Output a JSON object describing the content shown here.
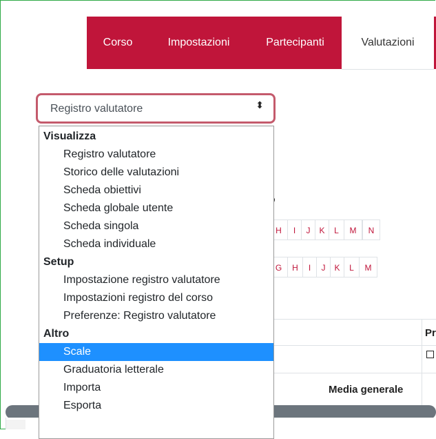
{
  "nav": {
    "tabs": [
      {
        "label": "Corso"
      },
      {
        "label": "Impostazioni"
      },
      {
        "label": "Partecipanti"
      },
      {
        "label": "Valutazioni"
      }
    ]
  },
  "select": {
    "value": "Registro valutatore",
    "arrow": "⬍"
  },
  "background": {
    "title_fragment": "B",
    "row1_letters": [
      "H",
      "I",
      "J",
      "K",
      "L",
      "M",
      "N"
    ],
    "row2_letters": [
      "G",
      "H",
      "I",
      "J",
      "K",
      "L",
      "M"
    ],
    "column_header_fragment": "Pr",
    "media_label": "Media generale"
  },
  "dropdown": {
    "groups": [
      {
        "label": "Visualizza",
        "options": [
          "Registro valutatore",
          "Storico delle valutazioni",
          "Scheda obiettivi",
          "Scheda globale utente",
          "Scheda singola",
          "Scheda individuale"
        ]
      },
      {
        "label": "Setup",
        "options": [
          "Impostazione registro valutatore",
          "Impostazioni registro del corso",
          "Preferenze: Registro valutatore"
        ]
      },
      {
        "label": "Altro",
        "options": [
          "Scale",
          "Graduatoria letterale",
          "Importa",
          "Esporta"
        ]
      }
    ],
    "selected": "Scale"
  },
  "colors": {
    "brand": "#c0153a",
    "highlight": "#1e90ff",
    "border": "#2eaa46"
  }
}
